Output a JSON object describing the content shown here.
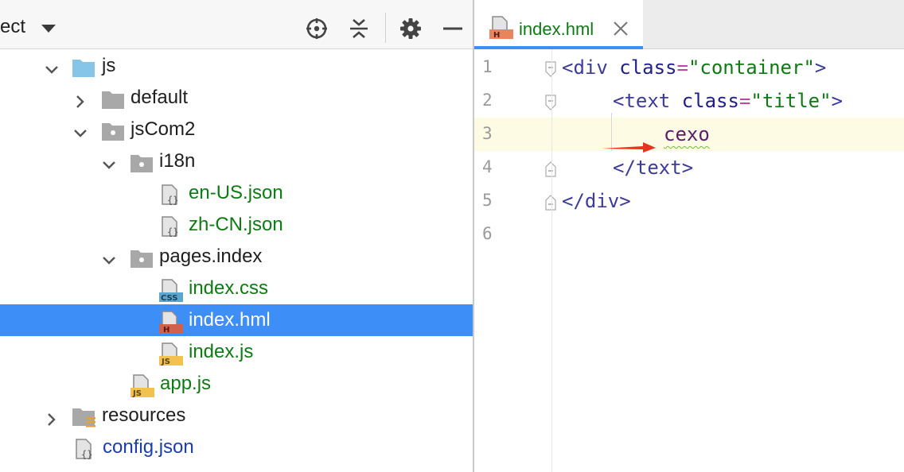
{
  "project_panel": {
    "title": "ect",
    "toolbar": {
      "locate_icon": "crosshair-icon",
      "collapse_icon": "collapse-all-icon",
      "settings_icon": "gear-icon",
      "hide_icon": "minimize-icon"
    },
    "tree": [
      {
        "label": "js",
        "kind": "folder-blue",
        "expanded": true,
        "level": 0
      },
      {
        "label": "default",
        "kind": "folder",
        "expanded": false,
        "level": 1
      },
      {
        "label": "jsCom2",
        "kind": "package",
        "expanded": true,
        "level": 1
      },
      {
        "label": "i18n",
        "kind": "package",
        "expanded": true,
        "level": 2
      },
      {
        "label": "en-US.json",
        "kind": "json",
        "level": 3
      },
      {
        "label": "zh-CN.json",
        "kind": "json",
        "level": 3
      },
      {
        "label": "pages.index",
        "kind": "package",
        "expanded": true,
        "level": 2
      },
      {
        "label": "index.css",
        "kind": "css",
        "level": 3
      },
      {
        "label": "index.hml",
        "kind": "hml",
        "level": 3,
        "selected": true
      },
      {
        "label": "index.js",
        "kind": "js",
        "level": 3
      },
      {
        "label": "app.js",
        "kind": "js",
        "level": 2
      },
      {
        "label": "resources",
        "kind": "resources",
        "expanded": false,
        "level": 0
      },
      {
        "label": "config.json",
        "kind": "json",
        "level": 0
      }
    ]
  },
  "editor": {
    "tab": {
      "label": "index.hml",
      "close_icon": "close-icon"
    },
    "lines": [
      {
        "n": "1"
      },
      {
        "n": "2"
      },
      {
        "n": "3",
        "current": true
      },
      {
        "n": "4"
      },
      {
        "n": "5"
      },
      {
        "n": "6"
      }
    ],
    "code": {
      "l1_open": "<div",
      "l1_attr": "class",
      "l1_eq": "=",
      "l1_val": "\"container\"",
      "l1_close": ">",
      "l2_open": "<text",
      "l2_attr": "class",
      "l2_eq": "=",
      "l2_val": "\"title\"",
      "l2_close": ">",
      "l3_text": "cexo",
      "l4_close": "</text>",
      "l5_close": "</div>"
    }
  },
  "colors": {
    "selection": "#3d8ef7",
    "file_green": "#0f7a14",
    "file_blue": "#1b3ea8",
    "arrow_red": "#e8331f"
  }
}
